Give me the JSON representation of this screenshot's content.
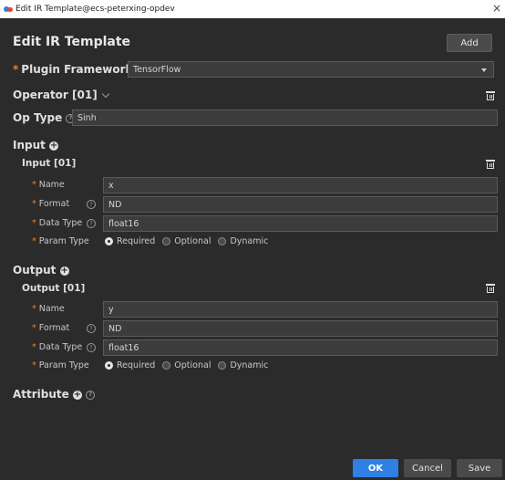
{
  "window": {
    "title": "Edit IR Template@ecs-peterxing-opdev",
    "close": "×"
  },
  "header": {
    "title": "Edit IR Template",
    "add_label": "Add"
  },
  "plugin_framework": {
    "label": "Plugin Framework",
    "required": "*",
    "value": "TensorFlow"
  },
  "operator": {
    "label": "Operator [01]",
    "op_type_label": "Op Type",
    "op_type_value": "Sinh"
  },
  "input": {
    "section_label": "Input",
    "item_label": "Input [01]",
    "name_label": "Name",
    "name_value": "x",
    "format_label": "Format",
    "format_value": "ND",
    "dtype_label": "Data Type",
    "dtype_value": "float16",
    "param_label": "Param Type",
    "options": [
      "Required",
      "Optional",
      "Dynamic"
    ],
    "selected": "Required"
  },
  "output": {
    "section_label": "Output",
    "item_label": "Output [01]",
    "name_label": "Name",
    "name_value": "y",
    "format_label": "Format",
    "format_value": "ND",
    "dtype_label": "Data Type",
    "dtype_value": "float16",
    "param_label": "Param Type",
    "options": [
      "Required",
      "Optional",
      "Dynamic"
    ],
    "selected": "Required"
  },
  "attribute": {
    "label": "Attribute"
  },
  "footer": {
    "ok": "OK",
    "cancel": "Cancel",
    "save": "Save"
  },
  "colors": {
    "accent": "#2f80e4",
    "required": "#e8842a",
    "background": "#2b2b2b"
  }
}
